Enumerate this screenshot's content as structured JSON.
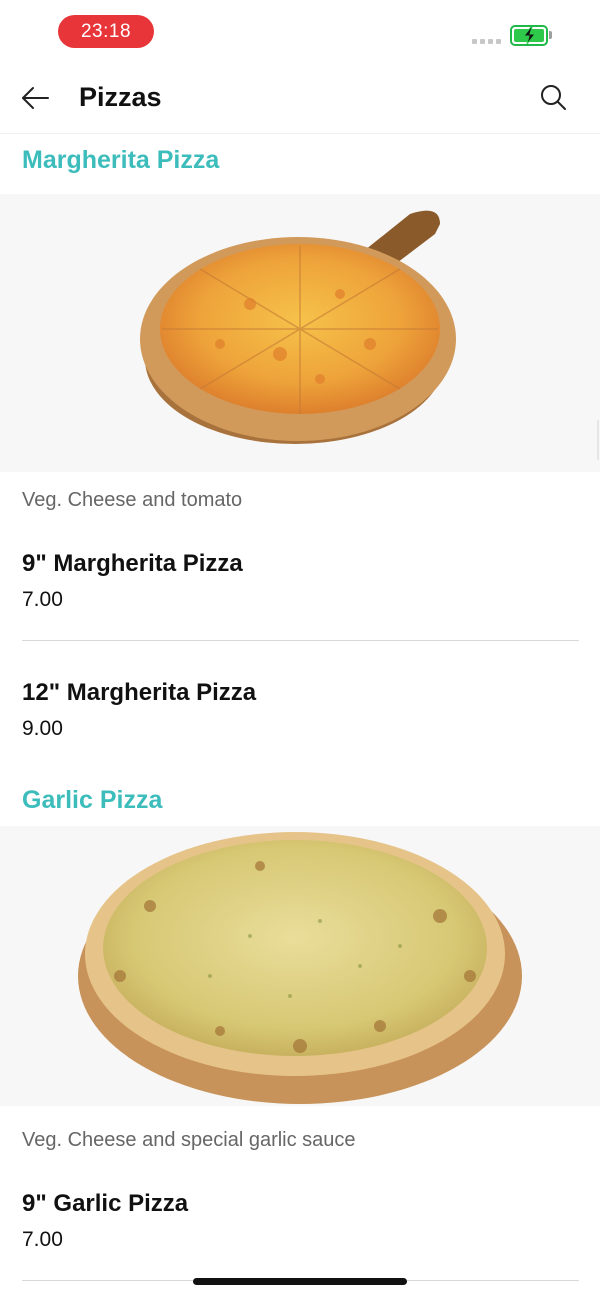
{
  "status_bar": {
    "time": "23:18",
    "battery_color": "#2ec84a",
    "time_pill_color": "#e8353a"
  },
  "header": {
    "title": "Pizzas",
    "back_icon": "arrow-left-icon",
    "search_icon": "search-icon"
  },
  "accent_color": "#3dbcbc",
  "sections": [
    {
      "title": "Margherita Pizza",
      "image": "margherita-pizza-image",
      "description": "Veg. Cheese and tomato",
      "items": [
        {
          "name": "9\" Margherita Pizza",
          "price": "7.00"
        },
        {
          "name": "12\" Margherita Pizza",
          "price": "9.00"
        }
      ]
    },
    {
      "title": "Garlic Pizza",
      "image": "garlic-pizza-image",
      "description": "Veg. Cheese and special garlic sauce",
      "items": [
        {
          "name": "9\" Garlic Pizza",
          "price": "7.00"
        }
      ]
    }
  ]
}
